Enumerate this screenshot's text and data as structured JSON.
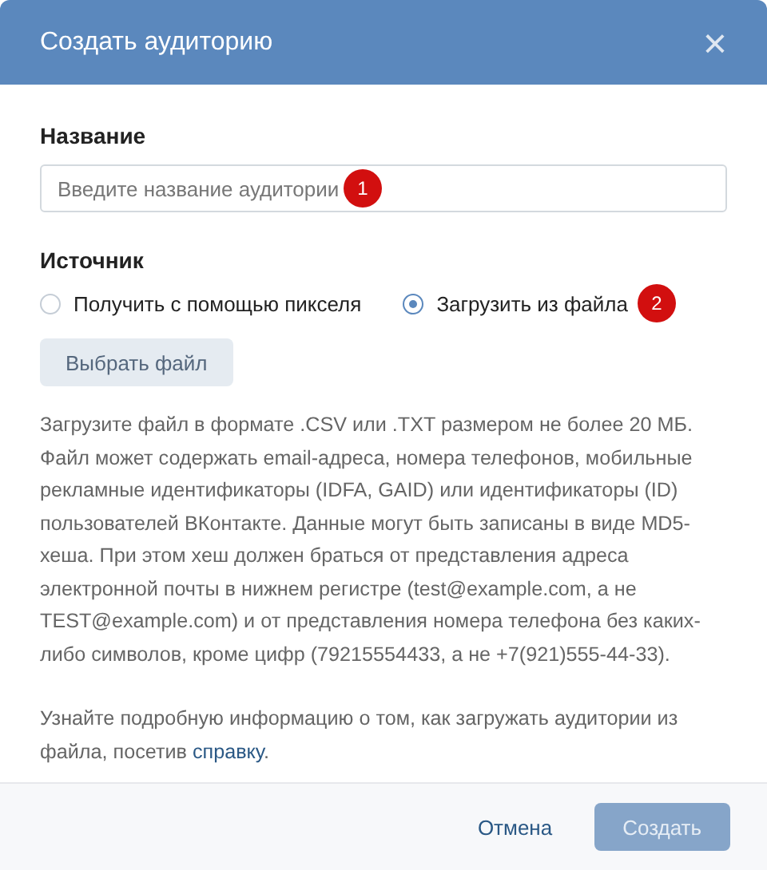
{
  "dialog": {
    "title": "Создать аудиторию",
    "close": "×"
  },
  "name_field": {
    "label": "Название",
    "placeholder": "Введите название аудитории",
    "marker": "1"
  },
  "source": {
    "label": "Источник",
    "options": [
      {
        "label": "Получить с помощью пикселя",
        "selected": false
      },
      {
        "label": "Загрузить из файла",
        "selected": true,
        "marker": "2"
      }
    ]
  },
  "file_button": "Выбрать файл",
  "description": "Загрузите файл в формате .CSV или .TXT размером не более 20 МБ. Файл может содержать email-адреса, номера телефонов, мобильные рекламные идентификаторы (IDFA, GAID) или идентификаторы (ID) пользователей ВКонтакте. Данные могут быть записаны в виде MD5-хеша. При этом хеш должен браться от представления адреса электронной почты в нижнем регистре (test@example.com, а не TEST@example.com) и от представления номера телефона без каких-либо символов, кроме цифр (79215554433, а не +7(921)555-44-33).",
  "help": {
    "before": "Узнайте подробную информацию о том, как загружать аудитории из файла, посетив",
    "link": "справку",
    "after": "."
  },
  "footer": {
    "cancel": "Отмена",
    "create": {
      "label": "Создать",
      "disabled": true
    }
  }
}
